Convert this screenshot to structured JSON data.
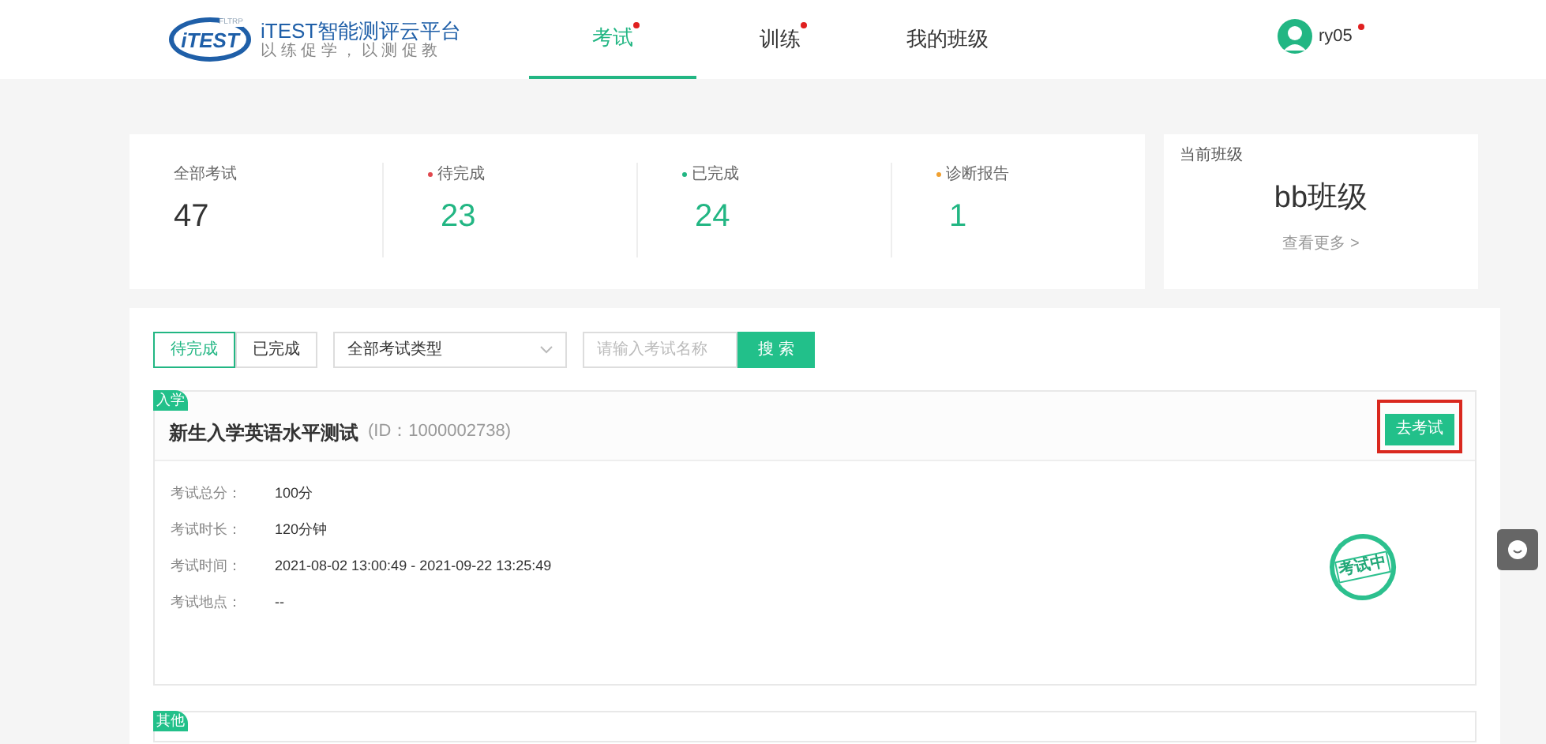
{
  "header": {
    "logo_text": "iTEST",
    "logo_badge": "FLTRP",
    "brand": "iTEST智能测评云平台",
    "slogan": "以 练 促 学 ， 以 测 促 教",
    "nav": [
      {
        "label": "考试",
        "selected": true,
        "dot": true
      },
      {
        "label": "训练",
        "selected": false,
        "dot": true
      },
      {
        "label": "我的班级",
        "selected": false,
        "dot": false
      }
    ],
    "user": {
      "name": "ry05",
      "dot": true
    }
  },
  "stats": [
    {
      "label": "全部考试",
      "value": "47"
    },
    {
      "label": "待完成",
      "value": "23",
      "color": "#e0484e"
    },
    {
      "label": "已完成",
      "value": "24",
      "color": "#22b683"
    },
    {
      "label": "诊断报告",
      "value": "1",
      "color": "#f0a030"
    }
  ],
  "current_class": {
    "label": "当前班级",
    "name": "bb班级",
    "more": "查看更多 >"
  },
  "filters": {
    "tabs": [
      {
        "label": "待完成",
        "selected": true
      },
      {
        "label": "已完成",
        "selected": false
      }
    ],
    "type_select": "全部考试类型",
    "search": {
      "placeholder": "请输入考试名称"
    },
    "search_button": "搜 索"
  },
  "exams": [
    {
      "tag": "入学",
      "title": "新生入学英语水平测试",
      "id": "(ID：1000002738)",
      "action": "去考试",
      "highlighted": true,
      "stamp": "考试中",
      "fields": [
        {
          "label": "考试总分：",
          "value": "100分"
        },
        {
          "label": "考试时长：",
          "value": "120分钟"
        },
        {
          "label": "考试时间：",
          "value": "2021-08-02 13:00:49 - 2021-09-22 13:25:49"
        },
        {
          "label": "考试地点：",
          "value": "--"
        }
      ]
    },
    {
      "tag": "其他"
    }
  ]
}
